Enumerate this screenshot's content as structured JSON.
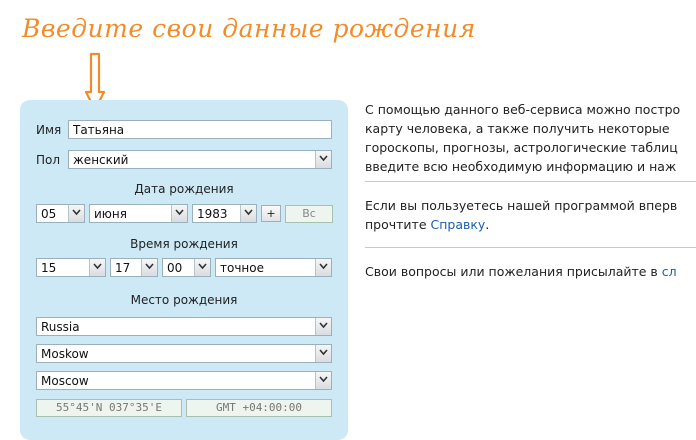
{
  "annotation": {
    "text": "Введите свои данные рождения",
    "color": "#f28c28"
  },
  "form": {
    "name_label": "Имя",
    "name_value": "Татьяна",
    "gender_label": "Пол",
    "gender_value": "женский",
    "birth_date_title": "Дата рождения",
    "day": "05",
    "month": "июня",
    "year": "1983",
    "plus_label": "+",
    "bc_label": "Вс",
    "birth_time_title": "Время рождения",
    "hour": "15",
    "minute": "17",
    "second": "00",
    "time_accuracy": "точное",
    "birth_place_title": "Место рождения",
    "country": "Russia",
    "region": "Moskow",
    "city": "Moscow",
    "coordinates": "55°45'N 037°35'E",
    "timezone": "GMT +04:00:00",
    "panel_color": "#cde9f6"
  },
  "info": {
    "paragraph1": [
      "С помощью данного веб-сервиса можно постро",
      "карту человека, а также получить некоторые",
      "гороскопы, прогнозы, астрологические таблиц",
      "введите всю необходимую информацию и наж"
    ],
    "paragraph2_line1": "Если вы пользуетесь нашей программой вперв",
    "paragraph2_prefix": "прочтите ",
    "paragraph2_link": "Справку",
    "paragraph2_suffix": ".",
    "paragraph3_text": "Свои вопросы или пожелания присылайте в ",
    "paragraph3_link": "сл",
    "link_color": "#1a5fa8"
  }
}
